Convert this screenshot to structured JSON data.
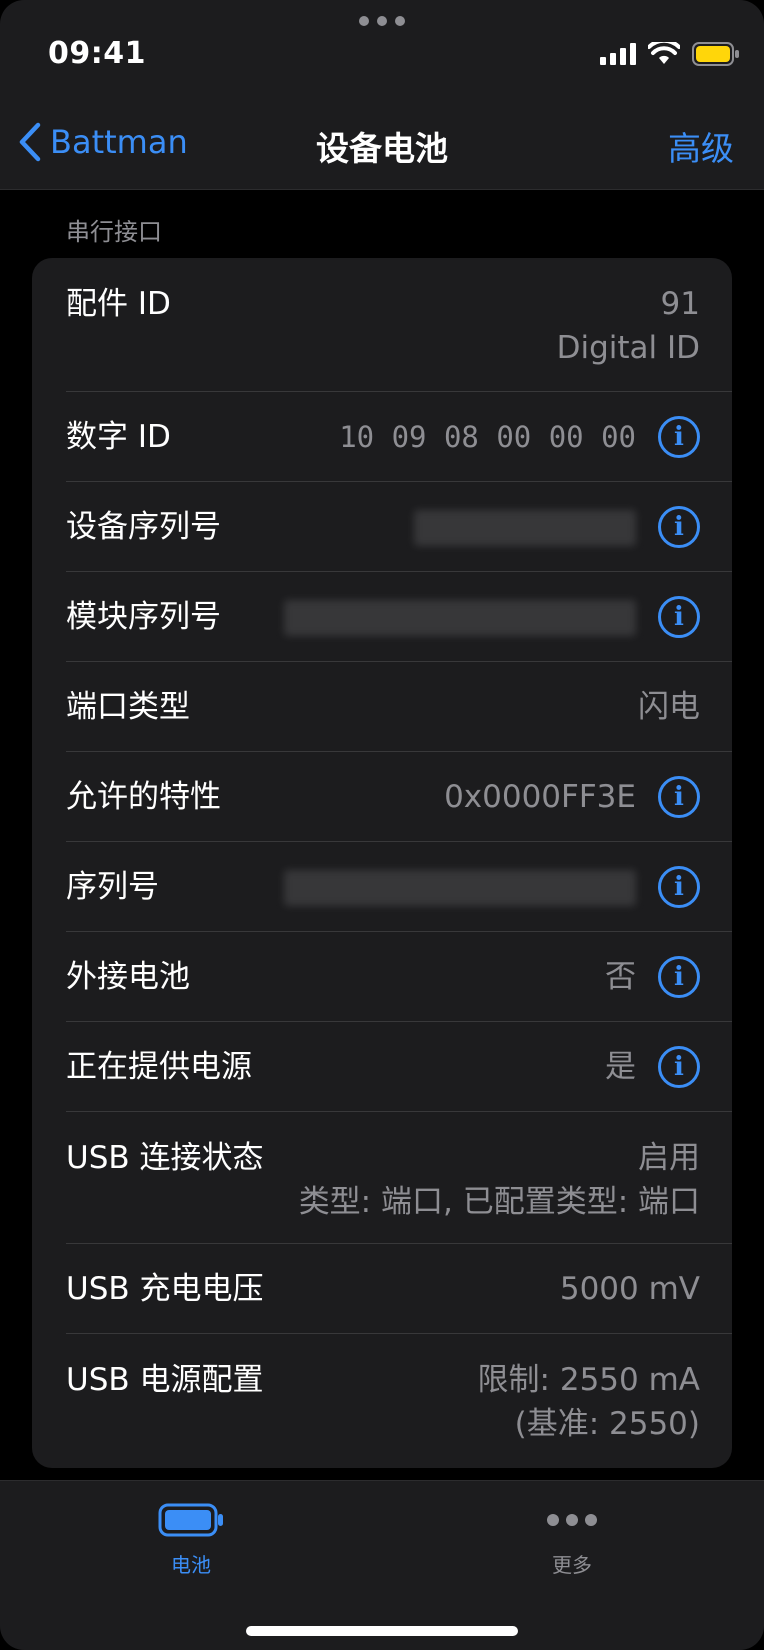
{
  "status": {
    "time": "09:41"
  },
  "nav": {
    "back_label": "Battman",
    "title": "设备电池",
    "right_label": "高级"
  },
  "section": {
    "header": "串行接口"
  },
  "rows": [
    {
      "label": "配件 ID",
      "value_line1": "91",
      "value_line2": "Digital ID"
    },
    {
      "label": "数字 ID",
      "value": "10 09 08 00 00 00"
    },
    {
      "label": "设备序列号"
    },
    {
      "label": "模块序列号"
    },
    {
      "label": "端口类型",
      "value": "闪电"
    },
    {
      "label": "允许的特性",
      "value": "0x0000FF3E"
    },
    {
      "label": "序列号"
    },
    {
      "label": "外接电池",
      "value": "否"
    },
    {
      "label": "正在提供电源",
      "value": "是"
    },
    {
      "label": "USB 连接状态",
      "value_line1": "启用",
      "value_line2": "类型: 端口, 已配置类型: 端口"
    },
    {
      "label": "USB 充电电压",
      "value": "5000 mV"
    },
    {
      "label": "USB 电源配置",
      "value_line1": "限制: 2550 mA",
      "value_line2": "(基准: 2550)"
    }
  ],
  "tabs": [
    {
      "label": "电池",
      "icon": "battery-icon"
    },
    {
      "label": "更多",
      "icon": "more-icon"
    }
  ],
  "colors": {
    "accent": "#3b8ef6",
    "background": "#000000",
    "cell": "#1c1c1e",
    "secondary_text": "#8e8e93"
  }
}
